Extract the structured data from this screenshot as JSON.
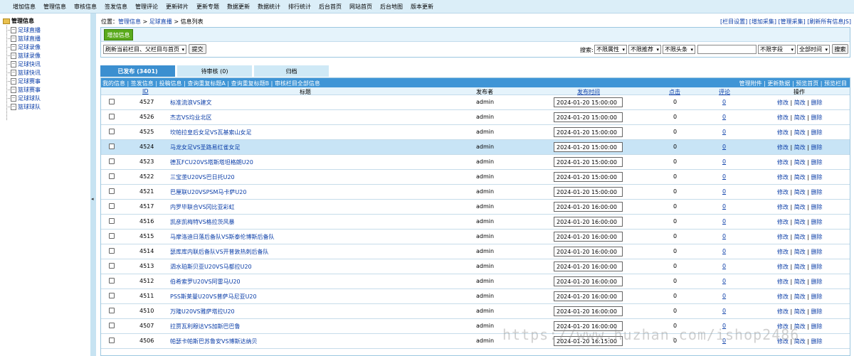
{
  "topnav": [
    "增加信息",
    "管理信息",
    "审核信息",
    "签发信息",
    "管理评论",
    "更新碎片",
    "更新专题",
    "数据更新",
    "数据统计",
    "排行统计",
    "后台首页",
    "网站首页",
    "后台地图",
    "版本更新"
  ],
  "sidebar": {
    "root": "管理信息",
    "items": [
      "足球直播",
      "篮球直播",
      "足球录像",
      "篮球录像",
      "足球快讯",
      "篮球快讯",
      "足球赛事",
      "篮球赛事",
      "足球球队",
      "篮球球队"
    ]
  },
  "breadcrumb": {
    "prefix": "位置：",
    "manage": "管理信息",
    "sep1": " > ",
    "column": "足球直播",
    "sep2": " > ",
    "current": "信息列表"
  },
  "toplinks": "[栏目设置] [增加采集] [管理采集] [刷新所有信息JS]",
  "toolbar": {
    "add_label": "增加信息",
    "refresh_select": "刷新当前栏目、父栏目与首页",
    "submit_label": "提交",
    "search_label": "搜索:",
    "attr_select": "不限属性",
    "recommend_select": "不限推荐",
    "headline_select": "不限头条",
    "search_value": "",
    "field_select": "不限字段",
    "time_select": "全部时间",
    "search_button": "搜索"
  },
  "tabs": [
    "已发布 (3401)",
    "待审核 (0)",
    "归档"
  ],
  "list_links_left": "我的信息 | 签发信息 | 投稿信息 | 查询重复标题A | 查询重复标题B | 审核栏目全部信息",
  "list_links_right": "管理附件 | 更新数据 | 预览首页 | 预览栏目",
  "columns": {
    "id": "ID",
    "title": "标题",
    "publisher": "发布者",
    "time": "发布时间",
    "clicks": "点击",
    "comments": "评论",
    "actions": "操作"
  },
  "actions": {
    "edit": "修改",
    "quick": "简改",
    "delete": "删除",
    "sep": " | "
  },
  "rows": [
    {
      "id": "4527",
      "title": "标准流浪VS建文",
      "publisher": "admin",
      "time": "2024-01-20 15:00:00",
      "clicks": "0",
      "comments": "0"
    },
    {
      "id": "4526",
      "title": "杰志VS均业北区",
      "publisher": "admin",
      "time": "2024-01-20 15:00:00",
      "clicks": "0",
      "comments": "0"
    },
    {
      "id": "4525",
      "title": "坎帕拉皇后女足VS瓦基索山女足",
      "publisher": "admin",
      "time": "2024-01-20 15:00:00",
      "clicks": "0",
      "comments": "0"
    },
    {
      "id": "4524",
      "title": "马龙女足VS圣路易红雀女足",
      "publisher": "admin",
      "time": "2024-01-20 15:00:00",
      "clicks": "0",
      "comments": "0"
    },
    {
      "id": "4523",
      "title": "德瓦FCU20VS塔斯塔坦格朗U20",
      "publisher": "admin",
      "time": "2024-01-20 15:00:00",
      "clicks": "0",
      "comments": "0"
    },
    {
      "id": "4522",
      "title": "三宝垄U20VS巴日托U20",
      "publisher": "admin",
      "time": "2024-01-20 15:00:00",
      "clicks": "0",
      "comments": "0"
    },
    {
      "id": "4521",
      "title": "巴厘联U20VSPSM马卡萨U20",
      "publisher": "admin",
      "time": "2024-01-20 15:00:00",
      "clicks": "0",
      "comments": "0"
    },
    {
      "id": "4517",
      "title": "内罗毕联合VS冈比亚彩虹",
      "publisher": "admin",
      "time": "2024-01-20 16:00:00",
      "clicks": "0",
      "comments": "0"
    },
    {
      "id": "4516",
      "title": "凯彦凯梅特VS格拉茨风暴",
      "publisher": "admin",
      "time": "2024-01-20 16:00:00",
      "clicks": "0",
      "comments": "0"
    },
    {
      "id": "4515",
      "title": "马摩洛迪日落后备队VS斯泰伦博斯后备队",
      "publisher": "admin",
      "time": "2024-01-20 16:00:00",
      "clicks": "0",
      "comments": "0"
    },
    {
      "id": "4514",
      "title": "瑟库库内联后备队VS开普敦热刺后备队",
      "publisher": "admin",
      "time": "2024-01-20 16:00:00",
      "clicks": "0",
      "comments": "0"
    },
    {
      "id": "4513",
      "title": "泗水珀斯贝亚U20VS马都拉U20",
      "publisher": "admin",
      "time": "2024-01-20 16:00:00",
      "clicks": "0",
      "comments": "0"
    },
    {
      "id": "4512",
      "title": "伯希索罗U20VS阿雷马U20",
      "publisher": "admin",
      "time": "2024-01-20 16:00:00",
      "clicks": "0",
      "comments": "0"
    },
    {
      "id": "4511",
      "title": "PSS斯莱曼U20VS普萨马尼亚U20",
      "publisher": "admin",
      "time": "2024-01-20 16:00:00",
      "clicks": "0",
      "comments": "0"
    },
    {
      "id": "4510",
      "title": "万隆U20VS雅萨塔拉U20",
      "publisher": "admin",
      "time": "2024-01-20 16:00:00",
      "clicks": "0",
      "comments": "0"
    },
    {
      "id": "4507",
      "title": "拉贾瓦利穆达VS加斯巴巴鲁",
      "publisher": "admin",
      "time": "2024-01-20 16:00:00",
      "clicks": "0",
      "comments": "0"
    },
    {
      "id": "4506",
      "title": "帕瑟卡帕斯巴苏鲁安VS博斯达纳贝",
      "publisher": "admin",
      "time": "2024-01-20 16:15:00",
      "clicks": "0",
      "comments": "0"
    }
  ],
  "watermark": "https://www.huzhan.com/ishop2486"
}
